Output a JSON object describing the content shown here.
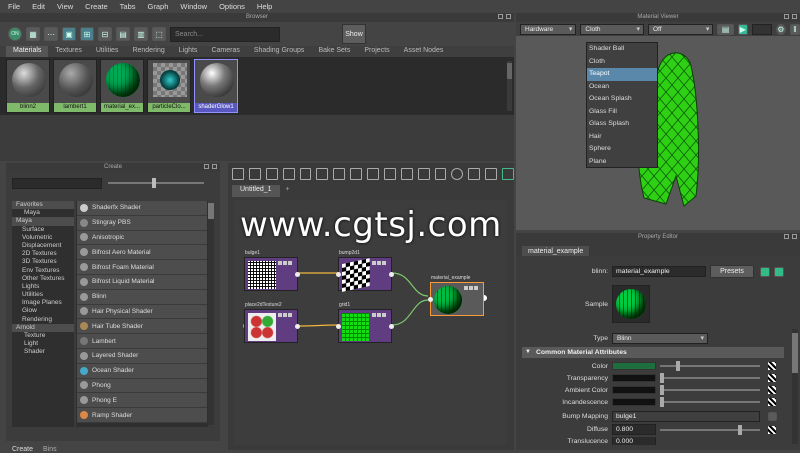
{
  "menubar": [
    "File",
    "Edit",
    "View",
    "Create",
    "Tabs",
    "Graph",
    "Window",
    "Options",
    "Help"
  ],
  "browser": {
    "title": "Browser",
    "search_placeholder": "Search...",
    "show_label": "Show",
    "tabs": [
      "Materials",
      "Textures",
      "Utilities",
      "Rendering",
      "Lights",
      "Cameras",
      "Shading Groups",
      "Bake Sets",
      "Projects",
      "Asset Nodes"
    ],
    "swatches": [
      "blinn2",
      "lambert1",
      "material_ex...",
      "particleClo...",
      "shaderGlow1"
    ]
  },
  "create": {
    "title": "Create",
    "tree": [
      "Favorites",
      "Maya",
      "Maya",
      "Surface",
      "Volumetric",
      "Displacement",
      "2D Textures",
      "3D Textures",
      "Env Textures",
      "Other Textures",
      "Lights",
      "Utilities",
      "Image Planes",
      "Glow",
      "Rendering",
      "Arnold",
      "Texture",
      "Light",
      "Shader"
    ],
    "nodes": [
      "Shaderfx Shader",
      "Stingray PBS",
      "Anisotropic",
      "Bifrost Aero Material",
      "Bifrost Foam Material",
      "Bifrost Liquid Material",
      "Blinn",
      "Hair Physical Shader",
      "Hair Tube Shader",
      "Lambert",
      "Layered Shader",
      "Ocean Shader",
      "Phong",
      "Phong E",
      "Ramp Shader"
    ],
    "bottom_tabs": [
      "Create",
      "Bins"
    ]
  },
  "graph": {
    "tab": "Untitled_1",
    "add_tab": "+",
    "nodes": [
      "bulge1",
      "bump2d1",
      "place2dTexture2",
      "grid1",
      "material_example"
    ]
  },
  "material_viewer": {
    "title": "Material Viewer",
    "renderer": "Hardware",
    "geometry": "Cloth",
    "env": "Off",
    "options": [
      "Shader Ball",
      "Cloth",
      "Teapot",
      "Ocean",
      "Ocean Splash",
      "Glass Fill",
      "Glass Splash",
      "Hair",
      "Sphere",
      "Plane"
    ],
    "highlighted": "Teapot"
  },
  "property_editor": {
    "title": "Property Editor",
    "tab": "material_example",
    "name_label": "blinn:",
    "name_value": "material_example",
    "presets": "Presets",
    "sample_label": "Sample",
    "type_label": "Type",
    "type_value": "Blinn",
    "section": "Common Material Attributes",
    "attrs": [
      "Color",
      "Transparency",
      "Ambient Color",
      "Incandescence",
      "Bump Mapping",
      "Diffuse",
      "Translucence"
    ],
    "bump_value": "bulge1",
    "diffuse_value": "0.800",
    "translucence_value": "0.000",
    "color_accent": "#1e6e3e"
  },
  "watermark": "www.cgtsj.com"
}
